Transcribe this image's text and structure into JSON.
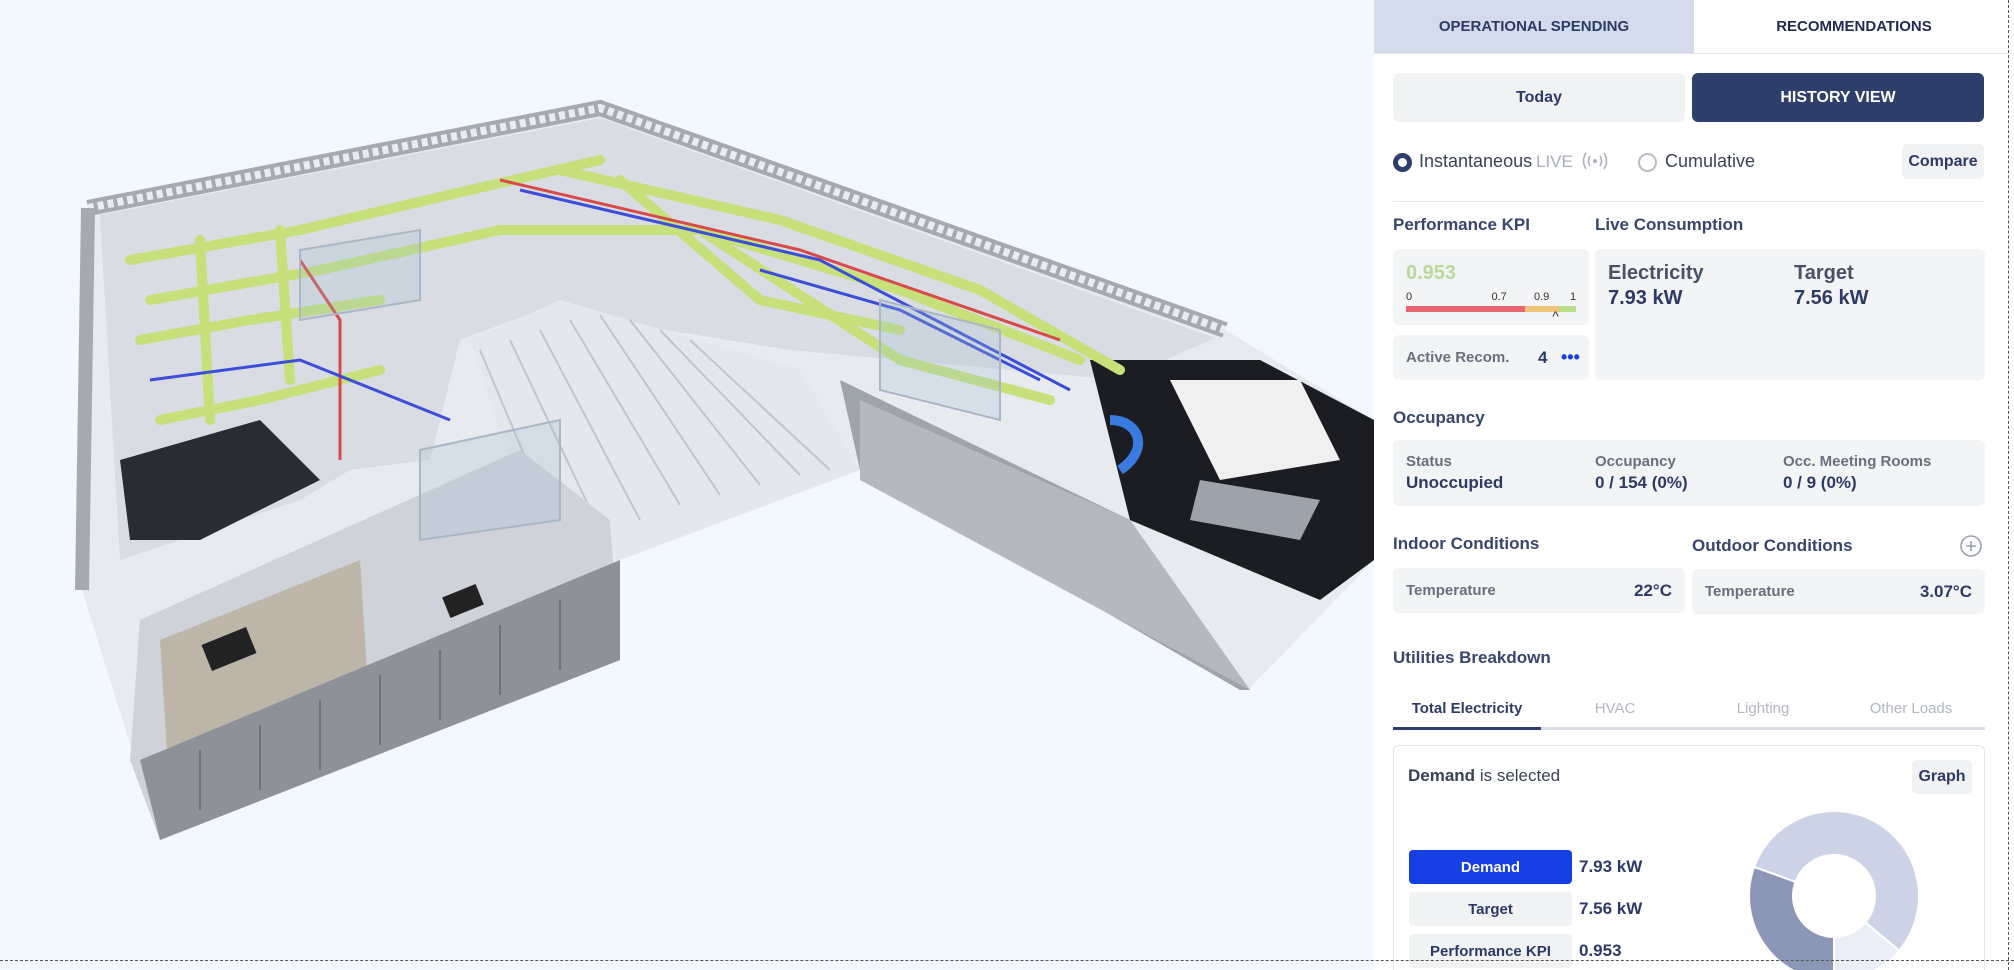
{
  "top_tabs": {
    "operational_spending": "OPERATIONAL SPENDING",
    "recommendations": "RECOMMENDATIONS"
  },
  "view_toggle": {
    "today": "Today",
    "history": "HISTORY VIEW"
  },
  "mode": {
    "instantaneous": "Instantaneous",
    "live": "LIVE",
    "live_icon": "broadcast-icon",
    "cumulative": "Cumulative",
    "compare": "Compare"
  },
  "performance_kpi": {
    "heading": "Performance KPI",
    "value": "0.953",
    "value_color": "#b7d99a",
    "scale_ticks": [
      "0",
      "0.7",
      "0.9",
      "1"
    ],
    "scale_colors": [
      "#e8646e",
      "#f0c478",
      "#b9dd8a"
    ],
    "kpi_fraction": 0.953
  },
  "active_recom": {
    "label": "Active Recom.",
    "count": "4",
    "more_icon": "ellipsis-icon"
  },
  "live_consumption": {
    "heading": "Live Consumption",
    "electricity_label": "Electricity",
    "electricity_value": "7.93 kW",
    "target_label": "Target",
    "target_value": "7.56 kW"
  },
  "occupancy": {
    "heading": "Occupancy",
    "status_label": "Status",
    "status_value": "Unoccupied",
    "occupancy_label": "Occupancy",
    "occupancy_value": "0 / 154 (0%)",
    "meeting_label": "Occ. Meeting Rooms",
    "meeting_value": "0 / 9 (0%)"
  },
  "indoor": {
    "heading": "Indoor Conditions",
    "temp_label": "Temperature",
    "temp_value": "22°C"
  },
  "outdoor": {
    "heading": "Outdoor Conditions",
    "temp_label": "Temperature",
    "temp_value": "3.07°C",
    "add_icon": "plus-circle-icon"
  },
  "utilities": {
    "heading": "Utilities Breakdown",
    "tabs": [
      "Total Electricity",
      "HVAC",
      "Lighting",
      "Other Loads"
    ],
    "selected_prefix": "Demand",
    "selected_suffix": "is selected",
    "graph_button": "Graph",
    "legend": [
      {
        "label": "Demand",
        "value": "7.93 kW"
      },
      {
        "label": "Target",
        "value": "7.56 kW"
      },
      {
        "label": "Performance KPI",
        "value": "0.953"
      }
    ],
    "donut_colors": [
      "#cdd3e6",
      "#8c97b8",
      "#eceef7"
    ]
  },
  "colors": {
    "accent": "#2e3f6b",
    "selected": "#1640e4",
    "hvac_duct": "#c6e07a",
    "pipe_red": "#d84a4a",
    "pipe_blue": "#3a4ed8"
  }
}
